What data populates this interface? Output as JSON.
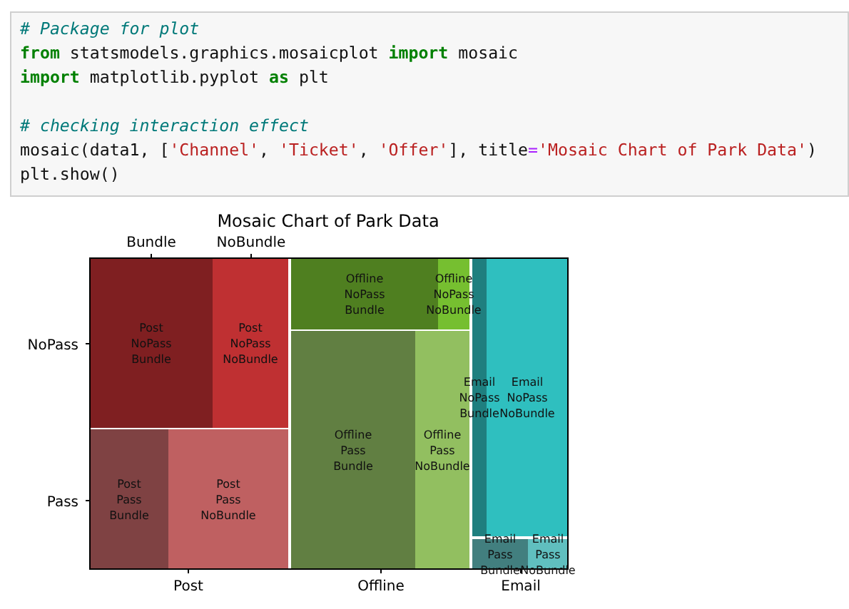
{
  "code_cell": {
    "blocks": [
      [
        [
          {
            "kind": "comment",
            "text": "# Package for plot"
          }
        ],
        [
          {
            "kind": "keyword",
            "text": "from"
          },
          {
            "kind": "plain",
            "text": " statsmodels.graphics.mosaicplot "
          },
          {
            "kind": "keyword",
            "text": "import"
          },
          {
            "kind": "plain",
            "text": " mosaic"
          }
        ],
        [
          {
            "kind": "keyword",
            "text": "import"
          },
          {
            "kind": "plain",
            "text": " matplotlib.pyplot "
          },
          {
            "kind": "keyword",
            "text": "as"
          },
          {
            "kind": "plain",
            "text": " plt"
          }
        ]
      ],
      [
        [
          {
            "kind": "comment",
            "text": "# checking interaction effect"
          }
        ],
        [
          {
            "kind": "plain",
            "text": "mosaic(data1, ["
          },
          {
            "kind": "string",
            "text": "'Channel'"
          },
          {
            "kind": "plain",
            "text": ", "
          },
          {
            "kind": "string",
            "text": "'Ticket'"
          },
          {
            "kind": "plain",
            "text": ", "
          },
          {
            "kind": "string",
            "text": "'Offer'"
          },
          {
            "kind": "plain",
            "text": "], title"
          },
          {
            "kind": "operator",
            "text": "="
          },
          {
            "kind": "string",
            "text": "'Mosaic Chart of Park Data'"
          },
          {
            "kind": "plain",
            "text": ")"
          }
        ],
        [
          {
            "kind": "plain",
            "text": "plt.show()"
          }
        ]
      ]
    ]
  },
  "mosaic_chart": {
    "title": "Mosaic Chart of Park Data",
    "top_labels": [
      "Bundle",
      "NoBundle"
    ],
    "left_labels": [
      "NoPass",
      "Pass"
    ],
    "bottom_labels": [
      "Post",
      "Offline",
      "Email"
    ],
    "tiles": [
      {
        "lines": [
          "Post",
          "NoPass",
          "Bundle"
        ],
        "color": "#7f1f21"
      },
      {
        "lines": [
          "Post",
          "NoPass",
          "NoBundle"
        ],
        "color": "#bf3032"
      },
      {
        "lines": [
          "Post",
          "Pass",
          "Bundle"
        ],
        "color": "#7f4243"
      },
      {
        "lines": [
          "Post",
          "Pass",
          "NoBundle"
        ],
        "color": "#bf6061"
      },
      {
        "lines": [
          "Offline",
          "NoPass",
          "Bundle"
        ],
        "color": "#4f7f20"
      },
      {
        "lines": [
          "Offline",
          "NoPass",
          "NoBundle"
        ],
        "color": "#76bf30"
      },
      {
        "lines": [
          "Offline",
          "Pass",
          "Bundle"
        ],
        "color": "#617f42"
      },
      {
        "lines": [
          "Offline",
          "Pass",
          "NoBundle"
        ],
        "color": "#92bf60"
      },
      {
        "lines": [
          "Email",
          "NoPass",
          "Bundle"
        ],
        "color": "#1f7f7f"
      },
      {
        "lines": [
          "Email",
          "NoPass",
          "NoBundle"
        ],
        "color": "#2fbfbf"
      },
      {
        "lines": [
          "Email",
          "Pass",
          "Bundle"
        ],
        "color": "#427f7f"
      },
      {
        "lines": [
          "Email",
          "Pass",
          "NoBundle"
        ],
        "color": "#60bfbf"
      }
    ]
  }
}
